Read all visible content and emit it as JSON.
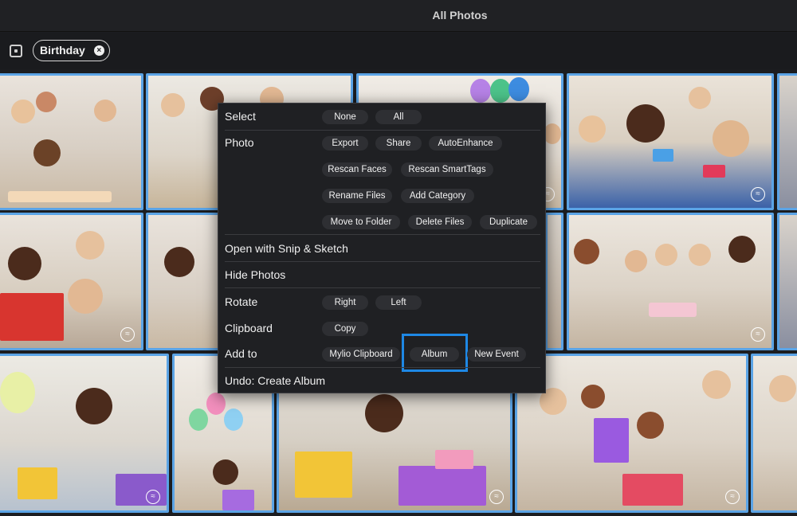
{
  "window": {
    "title": "All Photos"
  },
  "filter": {
    "chip_label": "Birthday",
    "chip_close": "×"
  },
  "tile_badge": "≈",
  "menu": {
    "select_label": "Select",
    "select_none": "None",
    "select_all": "All",
    "photo_label": "Photo",
    "photo_export": "Export",
    "photo_share": "Share",
    "photo_autoenhance": "AutoEnhance",
    "photo_rescan_faces": "Rescan Faces",
    "photo_rescan_smarttags": "Rescan SmartTags",
    "photo_rename_files": "Rename Files",
    "photo_add_category": "Add Category",
    "photo_move_to_folder": "Move to Folder",
    "photo_delete_files": "Delete Files",
    "photo_duplicate": "Duplicate",
    "open_with": "Open with Snip & Sketch",
    "hide_photos": "Hide Photos",
    "rotate_label": "Rotate",
    "rotate_right": "Right",
    "rotate_left": "Left",
    "clipboard_label": "Clipboard",
    "clipboard_copy": "Copy",
    "add_to_label": "Add to",
    "add_to_mylio_clipboard": "Mylio Clipboard",
    "add_to_album": "Album",
    "add_to_new_event": "New Event",
    "undo": "Undo: Create Album"
  },
  "colors": {
    "accent_border": "#5ba4e6",
    "highlight": "#1e88e5",
    "menu_bg": "#1f2023",
    "button_bg": "#2e2f33"
  }
}
